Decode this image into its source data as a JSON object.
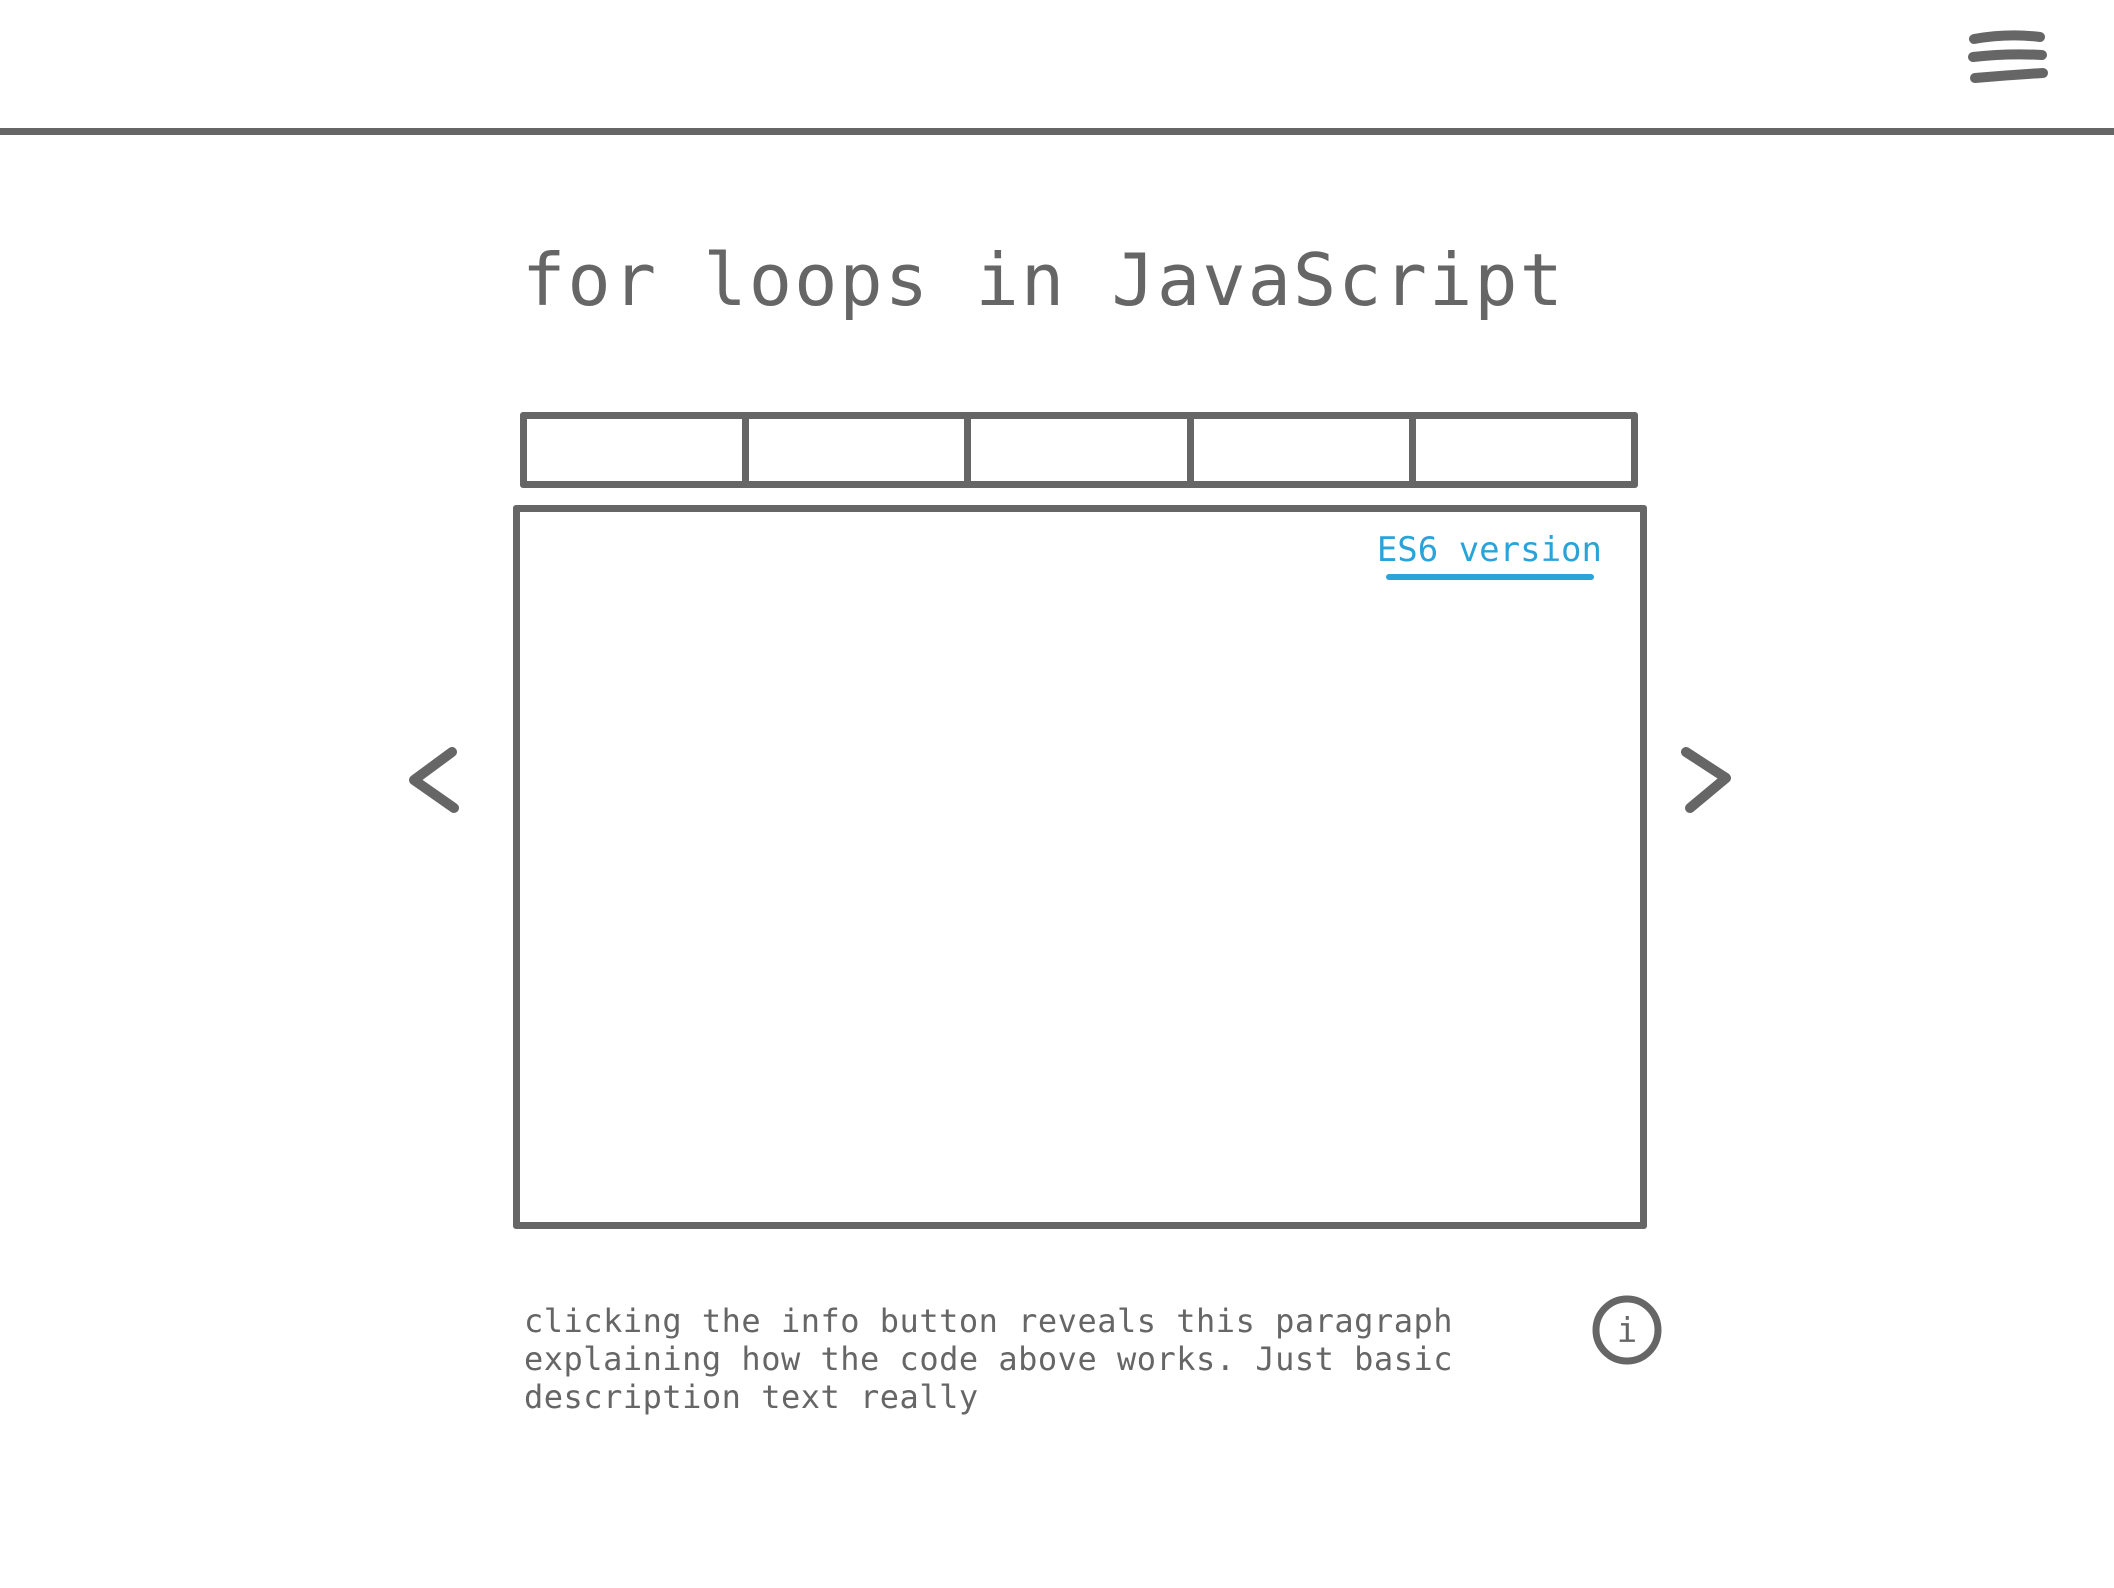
{
  "header": {
    "menu_icon": "hamburger-menu-icon"
  },
  "main": {
    "title": "for loops in JavaScript",
    "tabs": [
      {
        "label": ""
      },
      {
        "label": ""
      },
      {
        "label": ""
      },
      {
        "label": ""
      },
      {
        "label": ""
      }
    ],
    "code_panel": {
      "es6_link_label": "ES6 version"
    },
    "prev_icon": "chevron-left-icon",
    "next_icon": "chevron-right-icon",
    "description": "clicking the info button reveals this paragraph explaining how the code above works. Just basic description text really",
    "info_button": {
      "icon": "info-icon",
      "glyph": "i"
    }
  },
  "colors": {
    "wireframe": "#666666",
    "link": "#29a3d8",
    "background": "#ffffff"
  }
}
